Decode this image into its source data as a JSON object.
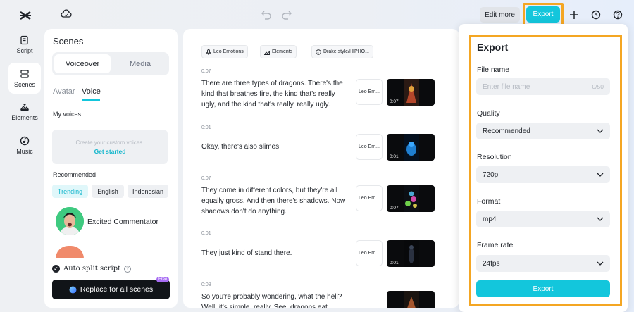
{
  "topbar": {
    "edit_more": "Edit more",
    "export": "Export"
  },
  "rail": {
    "items": [
      {
        "label": "Script",
        "icon": "script-icon"
      },
      {
        "label": "Scenes",
        "icon": "scenes-icon",
        "active": true
      },
      {
        "label": "Elements",
        "icon": "elements-icon"
      },
      {
        "label": "Music",
        "icon": "music-icon"
      }
    ]
  },
  "scenes": {
    "title": "Scenes",
    "seg_voiceover": "Voiceover",
    "seg_media": "Media",
    "tab_avatar": "Avatar",
    "tab_voice": "Voice",
    "my_voices": "My voices",
    "custom_line1": "Create your custom voices.",
    "custom_line2": "Get started",
    "recommended": "Recommended",
    "chips": [
      "Trending",
      "English",
      "Indonesian"
    ],
    "voice_name": "Excited Commentator",
    "auto_split": "Auto split script",
    "replace_btn": "Replace for all scenes",
    "free_badge": "Free"
  },
  "script": {
    "tags": [
      "Leo Emotions",
      "Elements",
      "Drake style/HIPHO..."
    ],
    "scenes": [
      {
        "duration": "0:07",
        "text": "There are three types of dragons. There's the kind that breathes fire, the kind that's really ugly, and the kind that's really, really ugly.",
        "voice": "Leo Em...",
        "thumb_dur": "0:07"
      },
      {
        "duration": "0:01",
        "text": "Okay, there's also slimes.",
        "voice": "Leo Em...",
        "thumb_dur": "0:01"
      },
      {
        "duration": "0:07",
        "text": "They come in different colors, but they're all equally gross. And then there's shadows. Now shadows don't do anything.",
        "voice": "Leo Em...",
        "thumb_dur": "0:07"
      },
      {
        "duration": "0:01",
        "text": "They just kind of stand there.",
        "voice": "Leo Em...",
        "thumb_dur": "0:01"
      },
      {
        "duration": "0:08",
        "text": "So you're probably wondering, what the hell? Well, it's simple, really. See, dragons eat",
        "voice": "",
        "thumb_dur": ""
      }
    ]
  },
  "export": {
    "title": "Export",
    "file_name_label": "File name",
    "file_name_placeholder": "Enter file name",
    "file_name_value": "",
    "file_name_count": "0/50",
    "quality_label": "Quality",
    "quality_value": "Recommended",
    "resolution_label": "Resolution",
    "resolution_value": "720p",
    "format_label": "Format",
    "format_value": "mp4",
    "frame_rate_label": "Frame rate",
    "frame_rate_value": "24fps",
    "export_button": "Export"
  },
  "colors": {
    "accent": "#13c6dc",
    "highlight": "#f4a623",
    "free_badge": "#a76cf3"
  }
}
